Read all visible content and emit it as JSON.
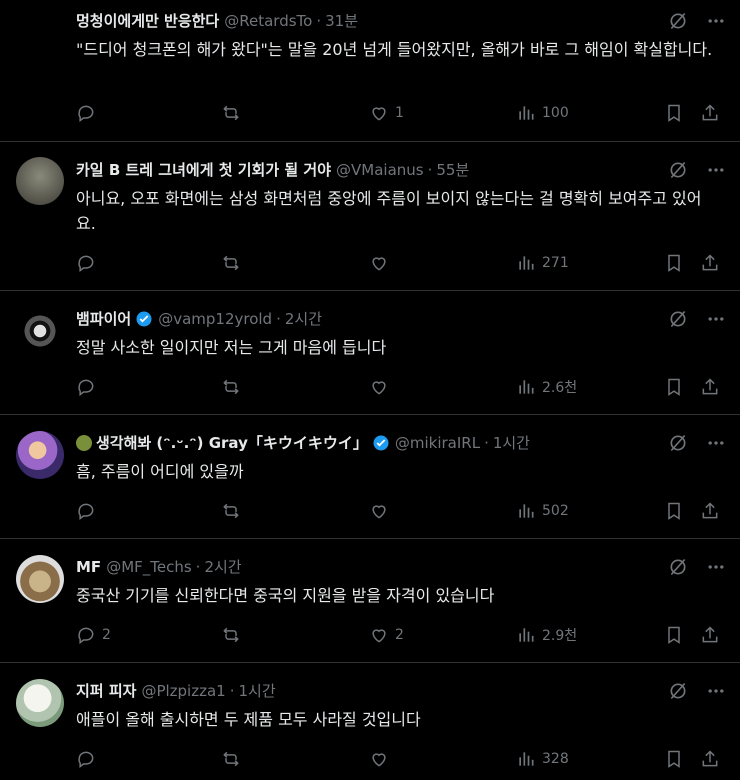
{
  "tweets": [
    {
      "name": "멍청이에게만 반응한다",
      "handle": "@RetardsTo",
      "time": "31분",
      "text": "\"드디어 청크폰의 해가 왔다\"는 말을 20년 넘게 들어왔지만, 올해가 바로 그 해임이 확실합니다.",
      "replies": "",
      "likes": "1",
      "views": "100",
      "avatar_color": "#000000"
    },
    {
      "name": "카일 B 트레 그녀에게 첫 기회가 될 거야",
      "handle": "@VMaianus",
      "time": "55분",
      "text": "아니요, 오포 화면에는 삼성 화면처럼 중앙에 주름이 보이지 않는다는 걸 명확히 보여주고 있어요.",
      "replies": "",
      "likes": "",
      "views": "271",
      "avatar_color": "#5a5a52"
    },
    {
      "name": "뱀파이어",
      "handle": "@vamp12yrold",
      "time": "2시간",
      "verified": true,
      "text": "정말 사소한 일이지만 저는 그게 마음에 듭니다",
      "replies": "",
      "likes": "",
      "views": "2.6천",
      "avatar_color": "#1a1a1a"
    },
    {
      "name": "생각해봐 (ᵔ.ᵕ.ᵔ) Gray「キウイキウイ」",
      "handle": "@mikiraIRL",
      "time": "1시간",
      "verified": true,
      "text": "흠, 주름이 어디에 있을까",
      "replies": "",
      "likes": "",
      "views": "502",
      "avatar_color": "#8a5fb0"
    },
    {
      "name": "MF",
      "handle": "@MF_Techs",
      "time": "2시간",
      "text": "중국산 기기를 신뢰한다면 중국의 지원을 받을 자격이 있습니다",
      "replies": "2",
      "likes": "2",
      "views": "2.9천",
      "avatar_color": "#b8a07a"
    },
    {
      "name": "지퍼 피자",
      "handle": "@Plzpizza1",
      "time": "1시간",
      "text": "애플이 올해 출시하면 두 제품 모두 사라질 것입니다",
      "replies": "",
      "likes": "",
      "views": "328",
      "avatar_color": "#cfd6cf"
    }
  ]
}
